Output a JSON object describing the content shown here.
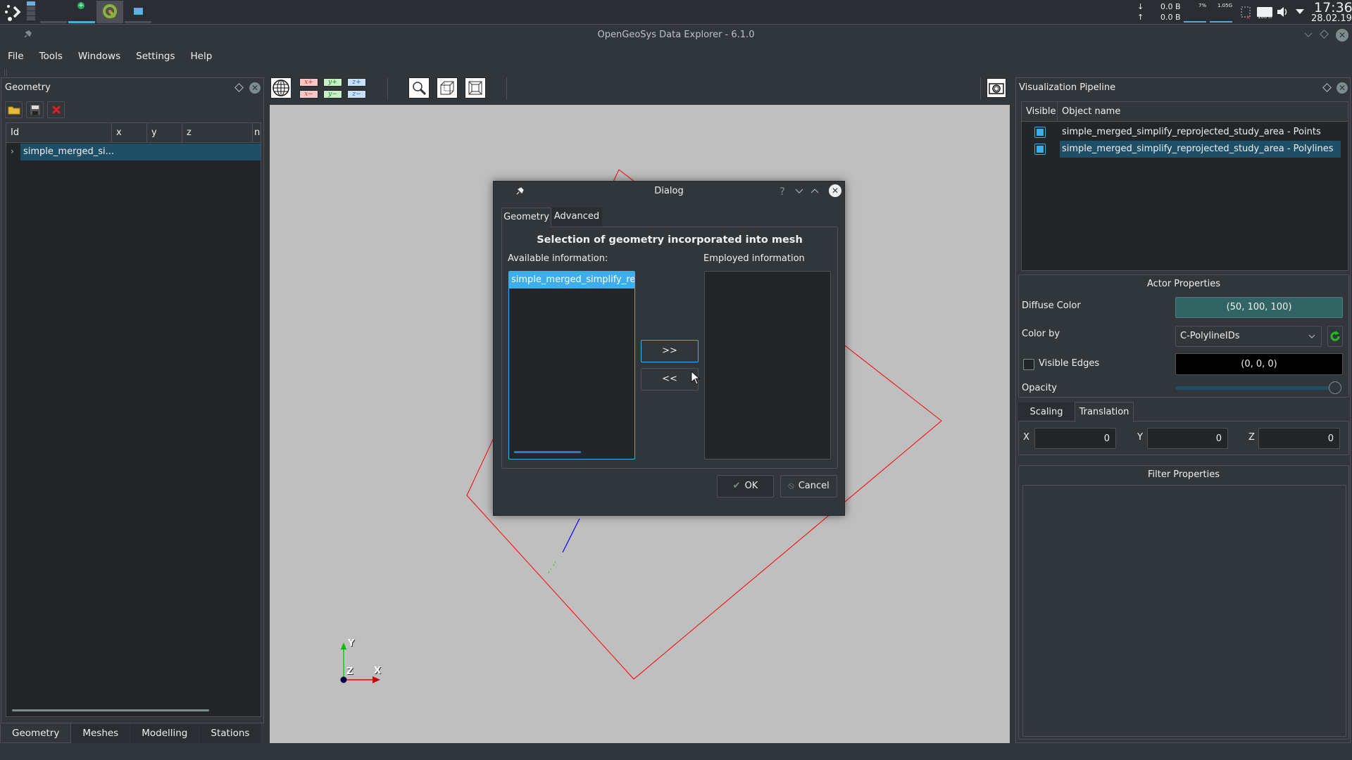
{
  "taskbar": {
    "net_down": "0.0 B",
    "net_up": "0.0 B",
    "cpu": "7%",
    "mem": "1.05G",
    "battery": "100%",
    "clock_time": "17:36",
    "clock_date": "28.02.19"
  },
  "window": {
    "title": "OpenGeoSys Data Explorer - 6.1.0"
  },
  "menu": [
    "File",
    "Tools",
    "Windows",
    "Settings",
    "Help"
  ],
  "geometry_dock": {
    "title": "Geometry",
    "columns": [
      "Id",
      "x",
      "y",
      "z",
      "n"
    ],
    "rows": [
      {
        "id": "simple_merged_si..."
      }
    ],
    "bottom_tabs": [
      "Geometry",
      "Meshes",
      "Modelling",
      "Stations"
    ],
    "active_tab": "Geometry"
  },
  "view_toolbar": {
    "axis_buttons": {
      "xplus": "x+",
      "xminus": "x−",
      "yplus": "y+",
      "yminus": "y−",
      "zplus": "z+",
      "zminus": "z−"
    }
  },
  "viewport": {
    "axes": {
      "x": "X",
      "y": "Y",
      "z": "Z"
    },
    "colors": {
      "polyline": "#ff0000",
      "background": "#bfbfbf"
    }
  },
  "pipeline_dock": {
    "title": "Visualization Pipeline",
    "columns": [
      "Visible",
      "Object name"
    ],
    "rows": [
      {
        "name": "simple_merged_simplify_reprojected_study_area - Points",
        "visible": true
      },
      {
        "name": "simple_merged_simplify_reprojected_study_area - Polylines",
        "visible": true,
        "selected": true
      }
    ],
    "actor_properties": {
      "title": "Actor Properties",
      "diffuse_label": "Diffuse Color",
      "diffuse_value": "(50, 100, 100)",
      "diffuse_color": "#326464",
      "color_by_label": "Color by",
      "color_by_value": "C-PolylineIDs",
      "visible_edges_label": "Visible Edges",
      "visible_edges_checked": false,
      "edge_color_value": "(0, 0, 0)",
      "opacity_label": "Opacity",
      "opacity": 1.0
    },
    "transform_tabs": [
      "Scaling",
      "Translation"
    ],
    "active_transform_tab": "Translation",
    "translation": {
      "x_label": "X",
      "x": "0",
      "y_label": "Y",
      "y": "0",
      "z_label": "Z",
      "z": "0"
    },
    "filter_properties": {
      "title": "Filter Properties"
    }
  },
  "dialog": {
    "title": "Dialog",
    "tabs": [
      "Geometry",
      "Advanced"
    ],
    "active_tab": "Geometry",
    "heading": "Selection of geometry incorporated into mesh",
    "available_label": "Available information:",
    "employed_label": "Employed information",
    "available_items": [
      "simple_merged_simplify_reprojected_study_area"
    ],
    "employed_items": [],
    "add_button": ">>",
    "remove_button": "<<",
    "ok_button": "OK",
    "cancel_button": "Cancel"
  }
}
